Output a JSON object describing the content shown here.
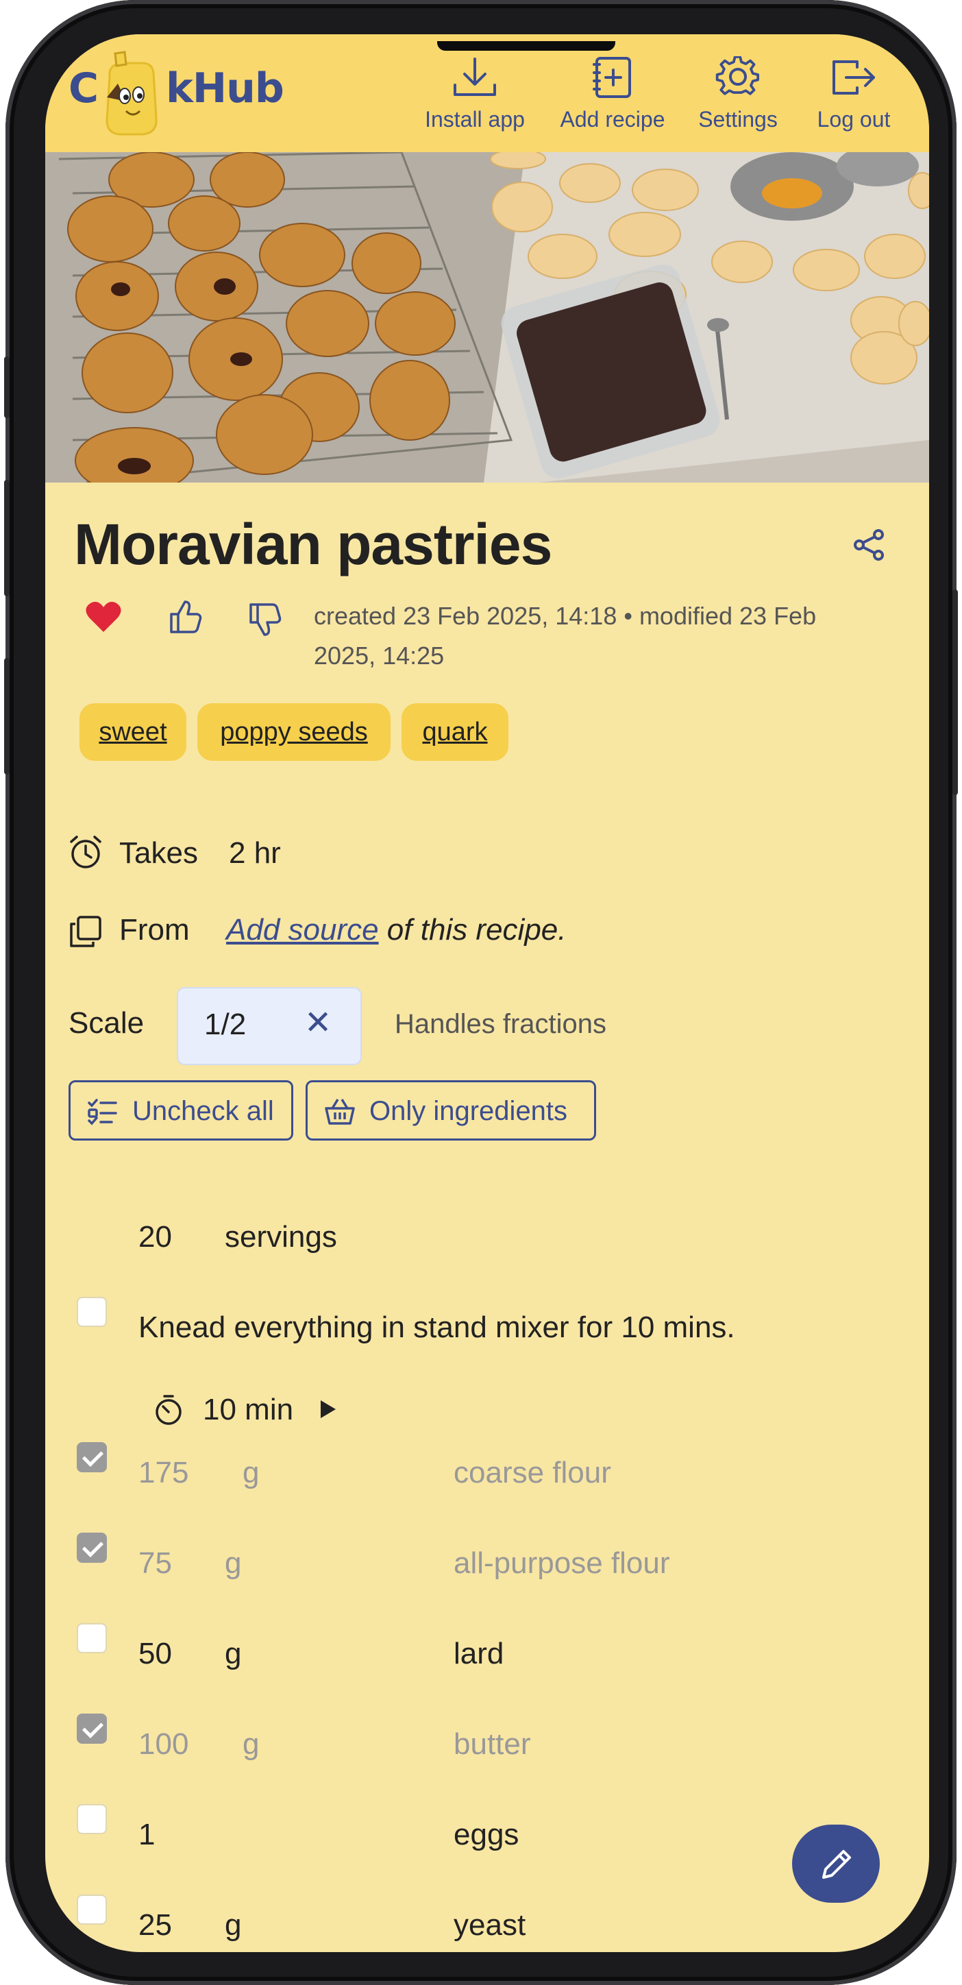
{
  "header": {
    "logo_left": "C",
    "logo_right": "kHub",
    "nav": [
      {
        "label": "Install app",
        "icon": "download-icon"
      },
      {
        "label": "Add recipe",
        "icon": "add-recipe-icon"
      },
      {
        "label": "Settings",
        "icon": "gear-icon"
      },
      {
        "label": "Log out",
        "icon": "logout-icon"
      }
    ]
  },
  "recipe": {
    "title": "Moravian pastries",
    "meta": "created 23 Feb 2025, 14:18 • modified 23 Feb 2025, 14:25",
    "tags": [
      "sweet",
      "poppy seeds",
      "quark"
    ],
    "takes_label": "Takes",
    "takes_value": "2 hr",
    "from_label": "From",
    "source_link": "Add source",
    "source_rest": " of this recipe.",
    "favorite": true
  },
  "scale": {
    "label": "Scale",
    "value": "1/2",
    "hint": "Handles fractions",
    "uncheck_all": "Uncheck all",
    "only_ingredients": "Only ingredients"
  },
  "servings": {
    "amount": "20",
    "label": "servings"
  },
  "step": {
    "text": "Knead everything in stand mixer for 10 mins.",
    "timer": "10 min"
  },
  "ingredients": [
    {
      "qty": "175",
      "unit": "g",
      "name": "coarse flour",
      "checked": true
    },
    {
      "qty": "75",
      "unit": "g",
      "name": "all-purpose flour",
      "checked": true
    },
    {
      "qty": "50",
      "unit": "g",
      "name": "lard",
      "checked": false
    },
    {
      "qty": "100",
      "unit": "g",
      "name": "butter",
      "checked": true
    },
    {
      "qty": "1",
      "unit": "",
      "name": "eggs",
      "checked": false
    },
    {
      "qty": "25",
      "unit": "g",
      "name": "yeast",
      "checked": false
    }
  ],
  "colors": {
    "header": "#f9d86e",
    "background": "#f8e6a3",
    "accent": "#3b4d8f",
    "tag": "#f6cf4c",
    "heart": "#e0263a"
  }
}
